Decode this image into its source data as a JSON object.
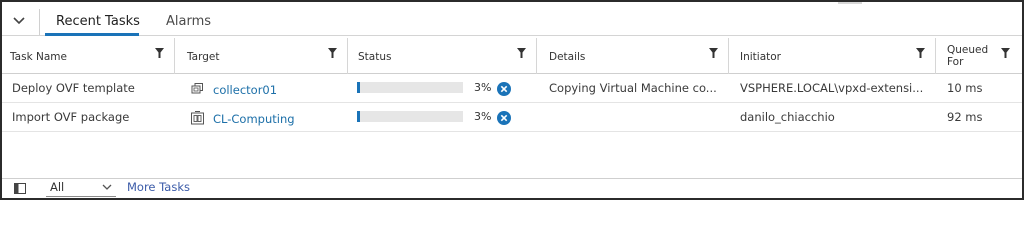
{
  "tabs": [
    {
      "label": "Recent Tasks",
      "active": true
    },
    {
      "label": "Alarms",
      "active": false
    }
  ],
  "table": {
    "columns": [
      {
        "label": "Task Name"
      },
      {
        "label": "Target"
      },
      {
        "label": "Status"
      },
      {
        "label": "Details"
      },
      {
        "label": "Initiator"
      },
      {
        "label": "Queued For"
      }
    ],
    "rows": [
      {
        "task_name": "Deploy OVF template",
        "target": "collector01",
        "target_icon": "vm-icon",
        "status_progress": 3,
        "status_text": "3%",
        "details": "Copying Virtual Machine co...",
        "initiator": "VSPHERE.LOCAL\\vpxd-extensi...",
        "queued_for": "10 ms"
      },
      {
        "task_name": "Import OVF package",
        "target": "CL-Computing",
        "target_icon": "cluster-icon",
        "status_progress": 3,
        "status_text": "3%",
        "details": "",
        "initiator": "danilo_chiacchio",
        "queued_for": "92 ms"
      }
    ]
  },
  "footer": {
    "filter_value": "All",
    "more_tasks_label": "More Tasks"
  },
  "colors": {
    "accent": "#1a73b8",
    "link": "#1c6fa8",
    "more_tasks": "#3b5ba8"
  }
}
